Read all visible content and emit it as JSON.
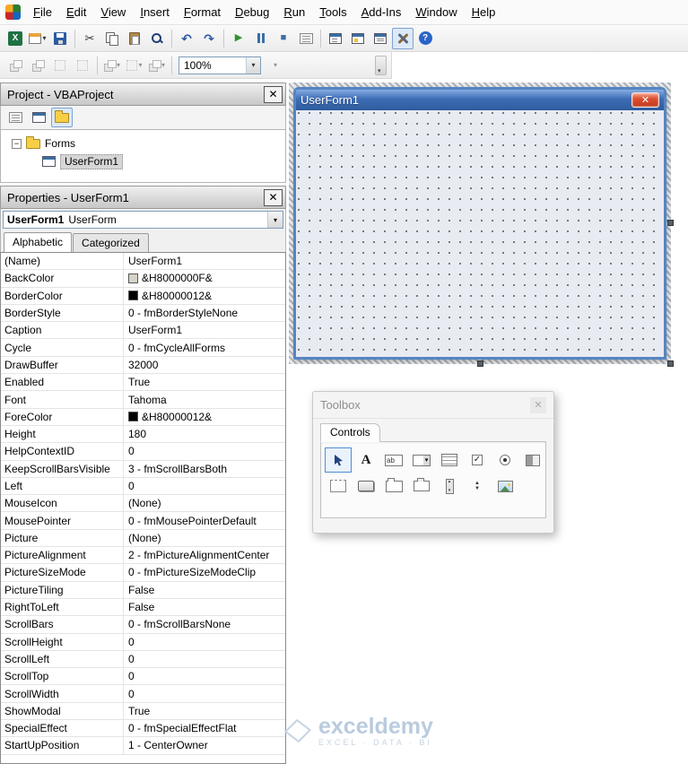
{
  "menubar": {
    "items": [
      "File",
      "Edit",
      "View",
      "Insert",
      "Format",
      "Debug",
      "Run",
      "Tools",
      "Add-Ins",
      "Window",
      "Help"
    ]
  },
  "toolbars": {
    "standard_icons": [
      "view-excel",
      "insert-userform",
      "save",
      "separator",
      "cut",
      "copy",
      "paste",
      "find",
      "separator",
      "undo",
      "redo",
      "separator",
      "run",
      "break",
      "reset",
      "design-mode",
      "separator",
      "project-explorer",
      "properties-window",
      "object-browser",
      "toolbox",
      "help"
    ],
    "userform_icons": [
      "bring-to-front",
      "send-to-back",
      "group",
      "ungroup",
      "separator",
      "align",
      "center",
      "make-same-size",
      "separator",
      "zoom-combo",
      "zoom-dropdown",
      "toolbar-overflow"
    ],
    "zoom_value": "100%"
  },
  "project_panel": {
    "title": "Project - VBAProject",
    "tree": {
      "folder_label": "Forms",
      "selected_item": "UserForm1"
    }
  },
  "properties_panel": {
    "title": "Properties - UserForm1",
    "object_selector": {
      "name": "UserForm1",
      "type": "UserForm"
    },
    "tabs": [
      {
        "label": "Alphabetic",
        "active": true
      },
      {
        "label": "Categorized",
        "active": false
      }
    ],
    "rows": [
      {
        "name": "(Name)",
        "value": "UserForm1"
      },
      {
        "name": "BackColor",
        "value": "&H8000000F&",
        "swatch": "#D6D2C6"
      },
      {
        "name": "BorderColor",
        "value": "&H80000012&",
        "swatch": "#000000"
      },
      {
        "name": "BorderStyle",
        "value": "0 - fmBorderStyleNone"
      },
      {
        "name": "Caption",
        "value": "UserForm1"
      },
      {
        "name": "Cycle",
        "value": "0 - fmCycleAllForms"
      },
      {
        "name": "DrawBuffer",
        "value": "32000"
      },
      {
        "name": "Enabled",
        "value": "True"
      },
      {
        "name": "Font",
        "value": "Tahoma"
      },
      {
        "name": "ForeColor",
        "value": "&H80000012&",
        "swatch": "#000000"
      },
      {
        "name": "Height",
        "value": "180"
      },
      {
        "name": "HelpContextID",
        "value": "0"
      },
      {
        "name": "KeepScrollBarsVisible",
        "value": "3 - fmScrollBarsBoth"
      },
      {
        "name": "Left",
        "value": "0"
      },
      {
        "name": "MouseIcon",
        "value": "(None)"
      },
      {
        "name": "MousePointer",
        "value": "0 - fmMousePointerDefault"
      },
      {
        "name": "Picture",
        "value": "(None)"
      },
      {
        "name": "PictureAlignment",
        "value": "2 - fmPictureAlignmentCenter"
      },
      {
        "name": "PictureSizeMode",
        "value": "0 - fmPictureSizeModeClip"
      },
      {
        "name": "PictureTiling",
        "value": "False"
      },
      {
        "name": "RightToLeft",
        "value": "False"
      },
      {
        "name": "ScrollBars",
        "value": "0 - fmScrollBarsNone"
      },
      {
        "name": "ScrollHeight",
        "value": "0"
      },
      {
        "name": "ScrollLeft",
        "value": "0"
      },
      {
        "name": "ScrollTop",
        "value": "0"
      },
      {
        "name": "ScrollWidth",
        "value": "0"
      },
      {
        "name": "ShowModal",
        "value": "True"
      },
      {
        "name": "SpecialEffect",
        "value": "0 - fmSpecialEffectFlat"
      },
      {
        "name": "StartUpPosition",
        "value": "1 - CenterOwner"
      }
    ]
  },
  "designer": {
    "title": "UserForm1"
  },
  "toolbox": {
    "title": "Toolbox",
    "tab_label": "Controls",
    "controls": [
      "select-objects",
      "label",
      "textbox",
      "combobox",
      "listbox",
      "checkbox",
      "optionbutton",
      "togglebutton",
      "frame",
      "commandbutton",
      "tabstrip",
      "multipage",
      "scrollbar",
      "spinbutton",
      "image"
    ],
    "selected_control": "select-objects"
  },
  "watermark": {
    "brand": "exceldemy",
    "tagline": "EXCEL · DATA · BI"
  },
  "colors": {
    "titlebar_blue": "#3E6DB5",
    "close_red": "#D8402A",
    "accent": "#7DA2CE"
  }
}
